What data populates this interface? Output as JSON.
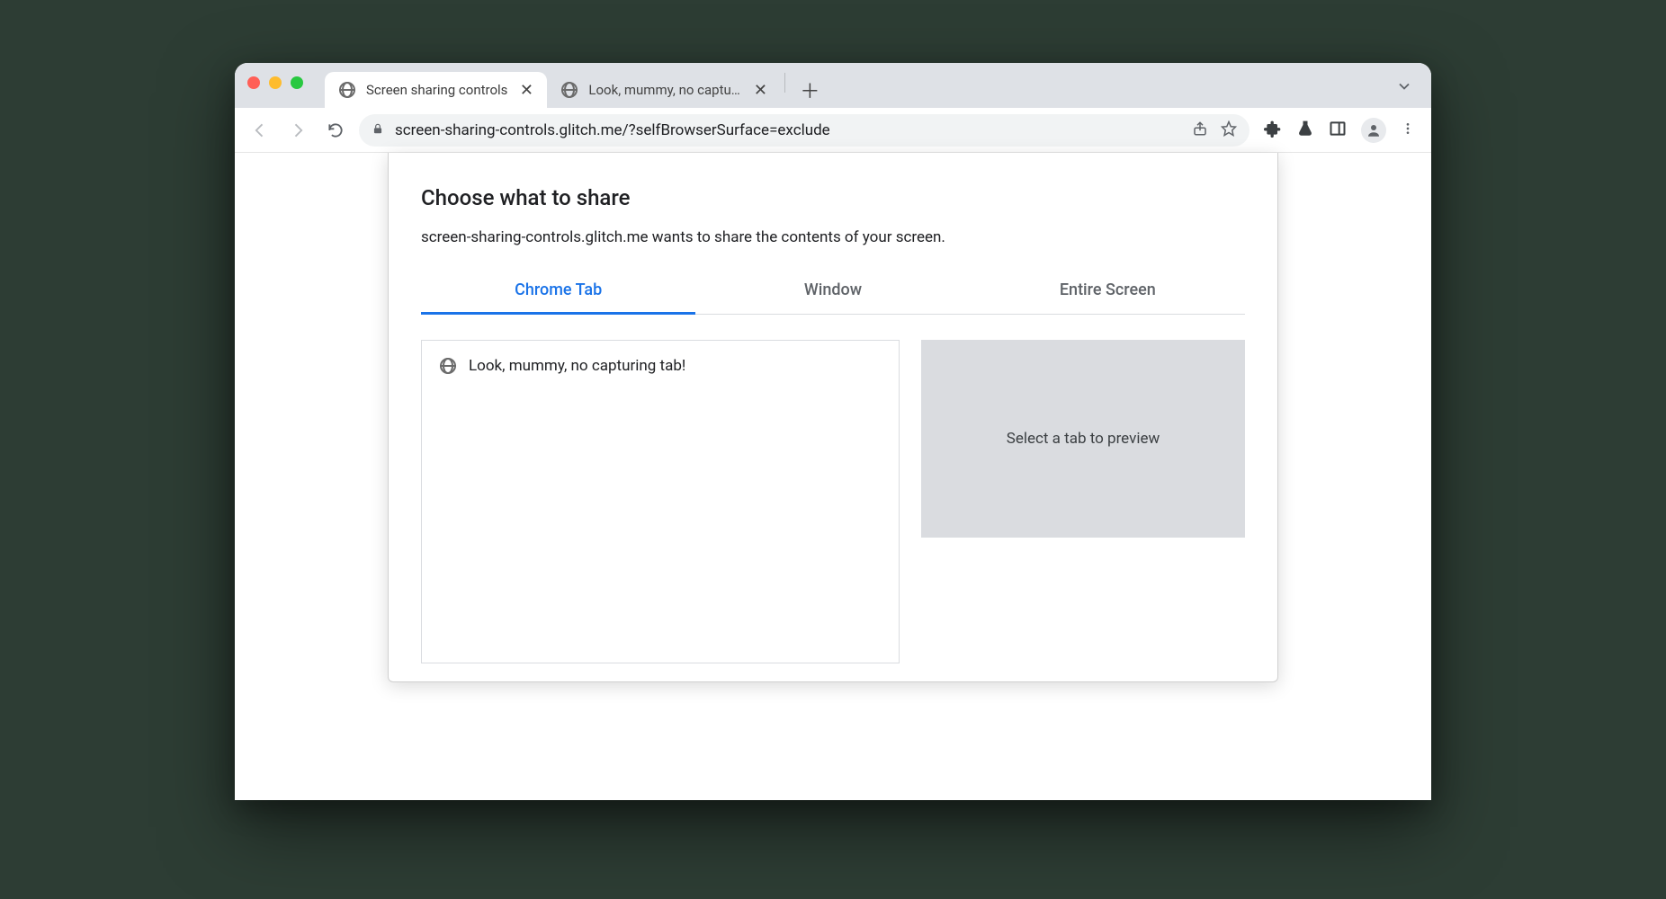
{
  "browser": {
    "tabs": [
      {
        "title": "Screen sharing controls",
        "active": true
      },
      {
        "title": "Look, mummy, no capturing tab",
        "active": false
      }
    ],
    "url": "screen-sharing-controls.glitch.me/?selfBrowserSurface=exclude"
  },
  "dialog": {
    "title": "Choose what to share",
    "subtitle": "screen-sharing-controls.glitch.me wants to share the contents of your screen.",
    "tabs": [
      {
        "label": "Chrome Tab",
        "active": true
      },
      {
        "label": "Window",
        "active": false
      },
      {
        "label": "Entire Screen",
        "active": false
      }
    ],
    "tab_list": [
      {
        "label": "Look, mummy, no capturing tab!"
      }
    ],
    "preview_placeholder": "Select a tab to preview"
  }
}
